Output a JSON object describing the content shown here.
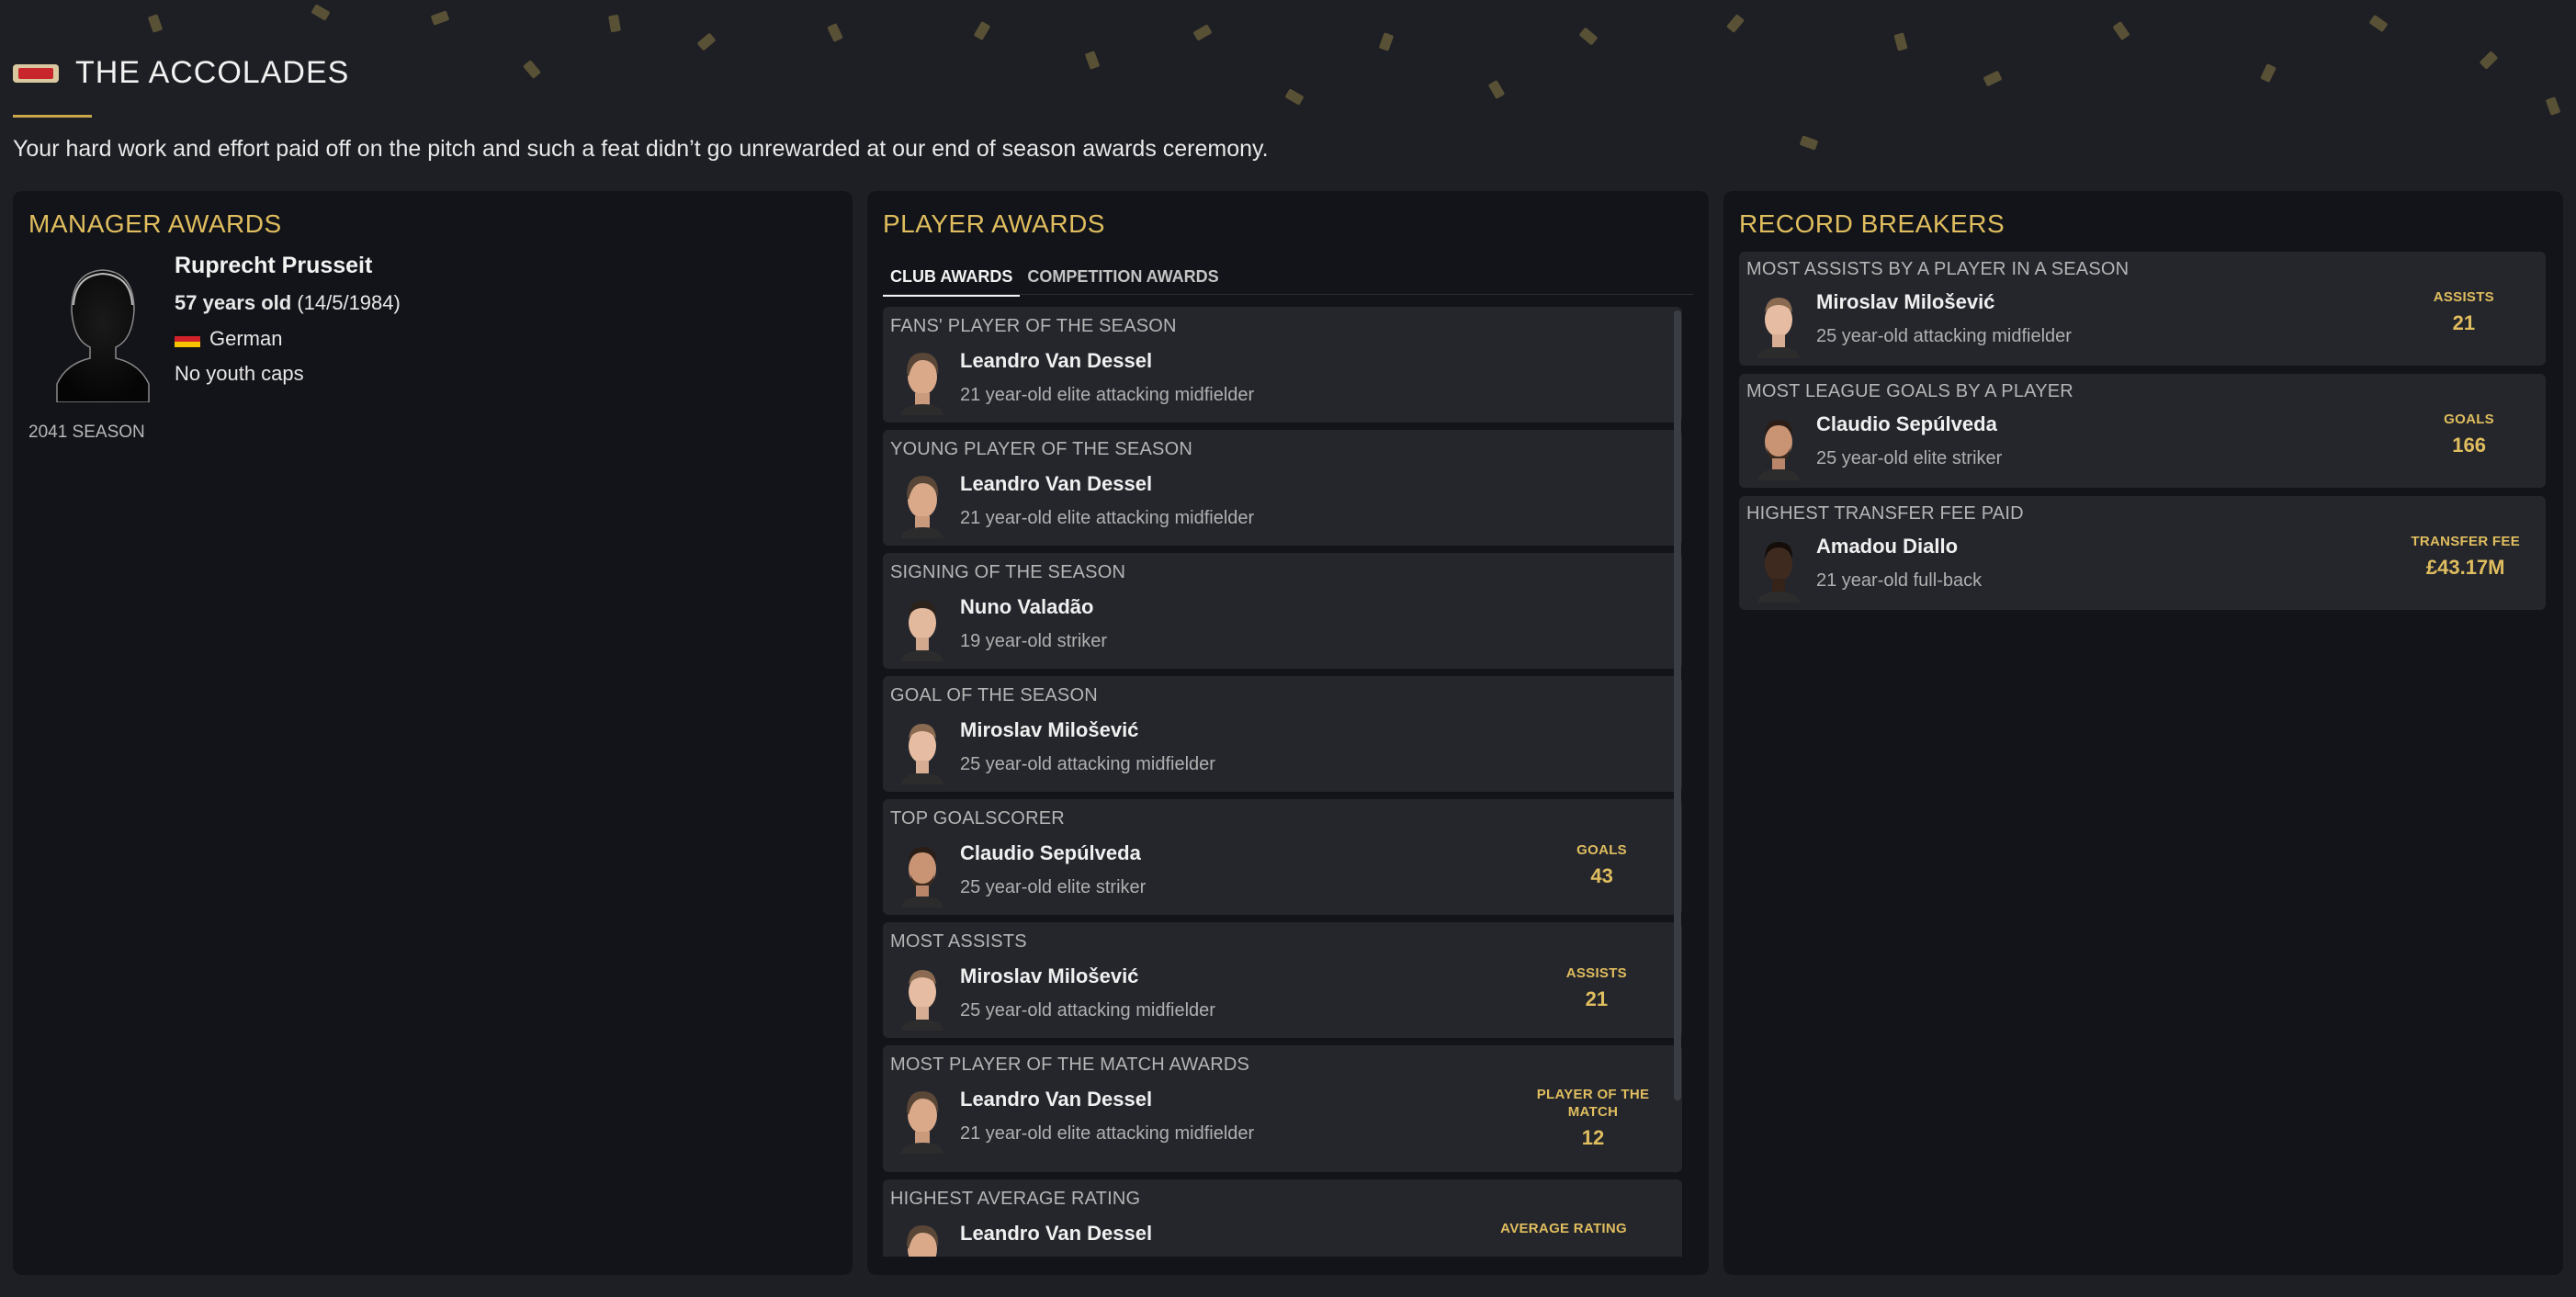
{
  "page": {
    "title": "THE ACCOLADES",
    "intro": "Your hard work and effort paid off on the pitch and such a feat didn’t go unrewarded at our end of season awards ceremony."
  },
  "manager": {
    "heading": "MANAGER AWARDS",
    "name": "Ruprecht Prusseit",
    "age": "57 years old",
    "dob": "(14/5/1984)",
    "nationality": "German",
    "caps": "No youth caps",
    "season": "2041 SEASON"
  },
  "players": {
    "heading": "PLAYER AWARDS",
    "tabs": [
      "CLUB AWARDS",
      "COMPETITION AWARDS"
    ],
    "awards": [
      {
        "category": "FANS' PLAYER OF THE SEASON",
        "name": "Leandro Van Dessel",
        "desc": "21 year-old elite attacking midfielder"
      },
      {
        "category": "YOUNG PLAYER OF THE SEASON",
        "name": "Leandro Van Dessel",
        "desc": "21 year-old elite attacking midfielder"
      },
      {
        "category": "SIGNING OF THE SEASON",
        "name": "Nuno Valadão",
        "desc": "19 year-old striker"
      },
      {
        "category": "GOAL OF THE SEASON",
        "name": "Miroslav Milošević",
        "desc": "25 year-old attacking midfielder"
      },
      {
        "category": "TOP GOALSCORER",
        "name": "Claudio Sepúlveda",
        "desc": "25 year-old elite striker",
        "stat_label": "GOALS",
        "stat_value": "43"
      },
      {
        "category": "MOST ASSISTS",
        "name": "Miroslav Milošević",
        "desc": "25 year-old attacking midfielder",
        "stat_label": "ASSISTS",
        "stat_value": "21"
      },
      {
        "category": "MOST PLAYER OF THE MATCH AWARDS",
        "name": "Leandro Van Dessel",
        "desc": "21 year-old elite attacking midfielder",
        "stat_label": "PLAYER OF THE MATCH",
        "stat_value": "12"
      },
      {
        "category": "HIGHEST AVERAGE RATING",
        "name": "Leandro Van Dessel",
        "desc": "",
        "stat_label": "AVERAGE RATING",
        "stat_value": ""
      }
    ]
  },
  "records": {
    "heading": "RECORD BREAKERS",
    "items": [
      {
        "category": "MOST ASSISTS BY A PLAYER IN A SEASON",
        "name": "Miroslav Milošević",
        "desc": "25 year-old attacking midfielder",
        "stat_label": "ASSISTS",
        "stat_value": "21"
      },
      {
        "category": "MOST LEAGUE GOALS BY A PLAYER",
        "name": "Claudio Sepúlveda",
        "desc": "25 year-old elite striker",
        "stat_label": "GOALS",
        "stat_value": "166"
      },
      {
        "category": "HIGHEST TRANSFER FEE PAID",
        "name": "Amadou Diallo",
        "desc": "21 year-old full-back",
        "stat_label": "TRANSFER FEE",
        "stat_value": "£43.17M"
      }
    ]
  },
  "colors": {
    "accent": "#e0bd5e",
    "panel": "#121419",
    "card": "#24262c",
    "background": "#1e1f24"
  }
}
